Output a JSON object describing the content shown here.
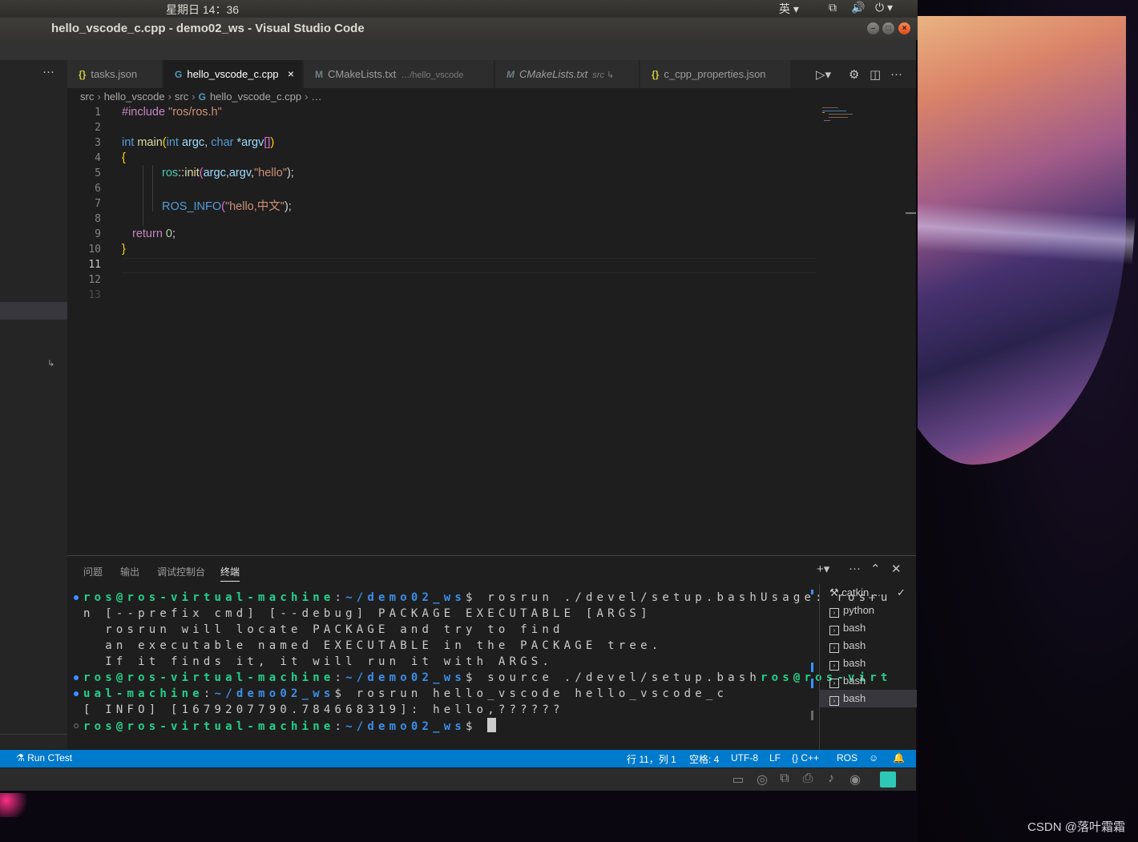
{
  "desktop": {
    "clock": "星期日 14：36",
    "input_method": "英",
    "watermark": "CSDN @落叶霜霜"
  },
  "window": {
    "title": "hello_vscode_c.cpp - demo02_ws - Visual Studio Code"
  },
  "tabs": [
    {
      "icon": "{}",
      "label": "tasks.json",
      "desc": ""
    },
    {
      "icon": "G",
      "label": "hello_vscode_c.cpp",
      "desc": "",
      "close": "×"
    },
    {
      "icon": "M",
      "label": "CMakeLists.txt",
      "desc": "…/hello_vscode"
    },
    {
      "icon": "M",
      "label": "CMakeLists.txt",
      "desc": "src ↳"
    },
    {
      "icon": "{}",
      "label": "c_cpp_properties.json",
      "desc": ""
    }
  ],
  "breadcrumb": [
    "src",
    "hello_vscode",
    "src",
    "hello_vscode_c.cpp",
    "…"
  ],
  "editor": {
    "line_numbers": [
      "1",
      "2",
      "3",
      "4",
      "5",
      "6",
      "7",
      "8",
      "9",
      "10",
      "11",
      "12",
      "13"
    ],
    "code": {
      "l1_a": "#include ",
      "l1_b": "\"ros/ros.h\"",
      "l3_a": "int ",
      "l3_b": "main",
      "l3_c": "(",
      "l3_d": "int ",
      "l3_e": "argc",
      "l3_f": ", ",
      "l3_g": "char ",
      "l3_h": "*argv",
      "l3_i": "[]",
      "l3_j": ")",
      "l4": "{",
      "l5_a": "ros",
      "l5_b": "::",
      "l5_c": "init",
      "l5_d": "(",
      "l5_e": "argc",
      "l5_f": ",",
      "l5_g": "argv",
      "l5_h": ",",
      "l5_i": "\"hello\"",
      "l5_j": ");",
      "l7_a": "ROS_INFO",
      "l7_b": "(",
      "l7_c": "\"hello,中文\"",
      "l7_d": ");",
      "l9_a": "return ",
      "l9_b": "0",
      "l9_c": ";",
      "l10": "}"
    }
  },
  "panel": {
    "tabs": [
      "问题",
      "输出",
      "调试控制台",
      "终端"
    ],
    "terminal": {
      "prompt_user": "ros@ros-virtual-machine",
      "prompt_sep": ":",
      "prompt_path": "~/demo02_ws",
      "prompt_dollar": "$ ",
      "l1_cmd": "rosrun ./devel/setup.bashUsage: rosru",
      "l2": "n [--prefix cmd] [--debug] PACKAGE EXECUTABLE [ARGS]",
      "l3": "  rosrun will locate PACKAGE and try to find",
      "l4": "  an executable named EXECUTABLE in the PACKAGE tree.",
      "l5": "  If it finds it, it will run it with ARGS.",
      "l6_cmd": "source ./devel/setup.bash",
      "l6_tail": "ros@ros-virt",
      "l7_head": "ual-machine",
      "l7_cmd": "rosrun hello_vscode hello_vscode_c",
      "l8": "[ INFO] [1679207790.784668319]: hello,??????"
    },
    "terminal_list": [
      {
        "icon": "tools-icon",
        "label": "catkin_..."
      },
      {
        "icon": "terminal-icon",
        "label": "python"
      },
      {
        "icon": "terminal-icon",
        "label": "bash"
      },
      {
        "icon": "terminal-icon",
        "label": "bash"
      },
      {
        "icon": "terminal-icon",
        "label": "bash"
      },
      {
        "icon": "terminal-icon",
        "label": "bash"
      },
      {
        "icon": "terminal-icon",
        "label": "bash"
      }
    ]
  },
  "statusbar": {
    "run_ctest": "Run CTest",
    "position": "行 11，列 1",
    "spaces": "空格: 4",
    "encoding": "UTF-8",
    "eol": "LF",
    "language": "C++",
    "ros": "ROS"
  },
  "colors": {
    "statusbar": "#007acc",
    "editor_bg": "#1e1e1e",
    "prompt_green": "#23d18b",
    "prompt_blue": "#3b8eea"
  }
}
